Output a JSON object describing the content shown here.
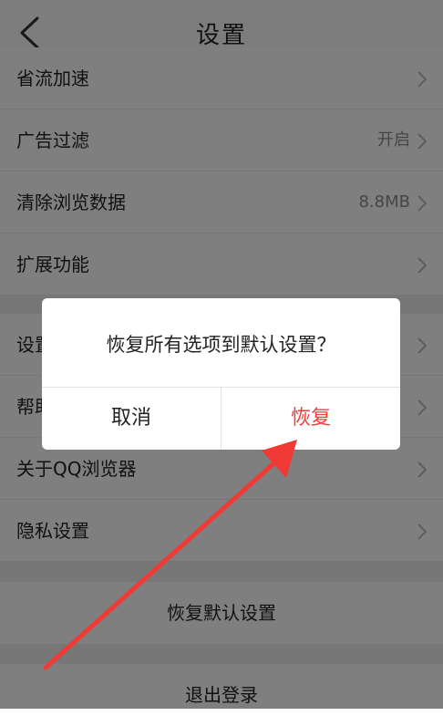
{
  "header": {
    "title": "设置"
  },
  "settings_group_1": [
    {
      "label": "省流加速",
      "value": ""
    },
    {
      "label": "广告过滤",
      "value": "开启"
    },
    {
      "label": "清除浏览数据",
      "value": "8.8MB"
    },
    {
      "label": "扩展功能",
      "value": ""
    }
  ],
  "settings_group_2": [
    {
      "label": "设置",
      "value": ""
    },
    {
      "label": "帮助",
      "value": ""
    },
    {
      "label": "关于QQ浏览器",
      "value": ""
    },
    {
      "label": "隐私设置",
      "value": ""
    }
  ],
  "restore_defaults_label": "恢复默认设置",
  "logout_label": "退出登录",
  "dialog": {
    "message": "恢复所有选项到默认设置？",
    "cancel_label": "取消",
    "confirm_label": "恢复"
  },
  "colors": {
    "accent": "#e8413a",
    "overlay": "rgba(0,0,0,0.5)"
  }
}
